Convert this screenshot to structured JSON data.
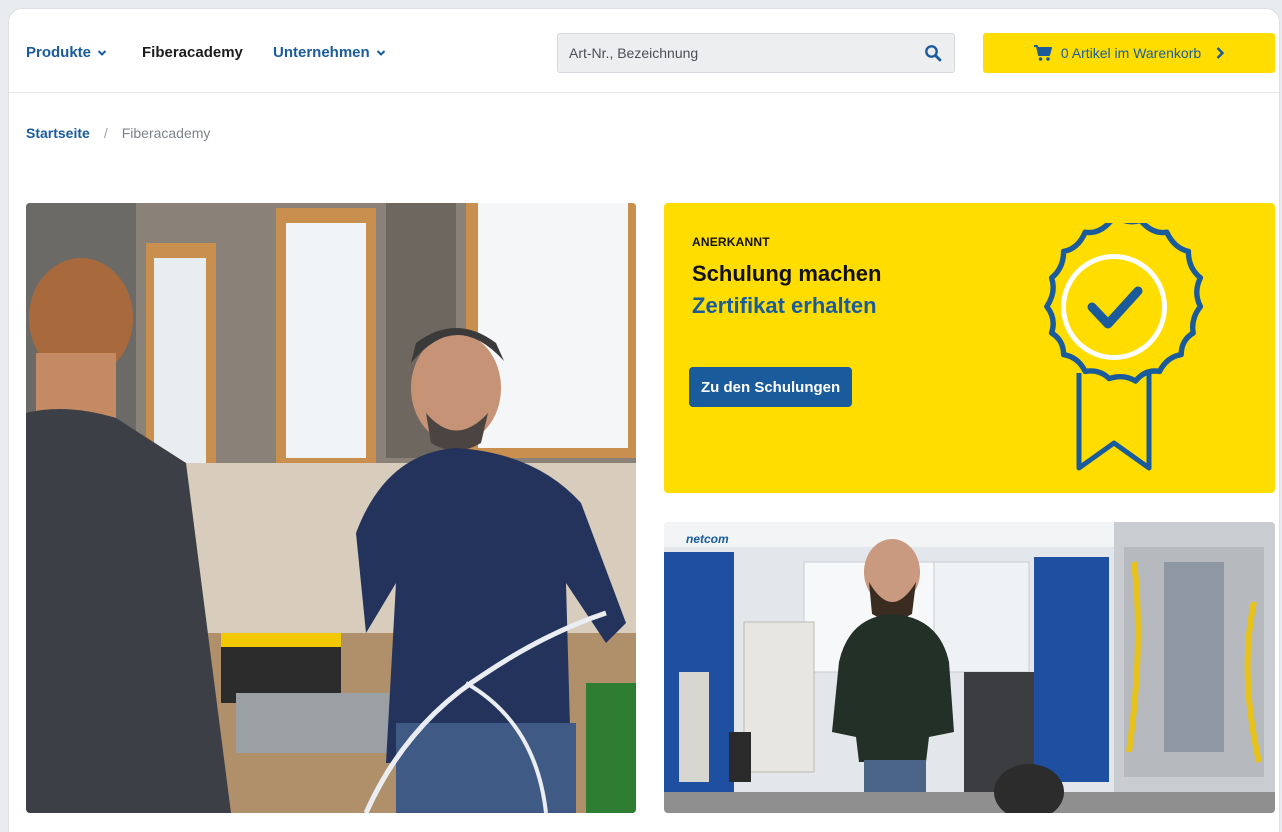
{
  "header": {
    "nav": [
      {
        "label": "Produkte"
      },
      {
        "label": "Fiberacademy"
      },
      {
        "label": "Unternehmen"
      }
    ],
    "search": {
      "placeholder": "Art-Nr., Bezeichnung"
    },
    "cart": {
      "label": "0 Artikel im Warenkorb"
    }
  },
  "breadcrumb": {
    "home": "Startseite",
    "separator": "/",
    "current": "Fiberacademy"
  },
  "promo": {
    "kicker": "ANERKANNT",
    "title": "Schulung machen",
    "subtitle": "Zertifikat erhalten",
    "button": "Zu den Schulungen"
  },
  "photo_right": {
    "logo_text": "netcom"
  },
  "colors": {
    "brand_blue": "#1a5b9c",
    "brand_yellow": "#ffdd00"
  }
}
